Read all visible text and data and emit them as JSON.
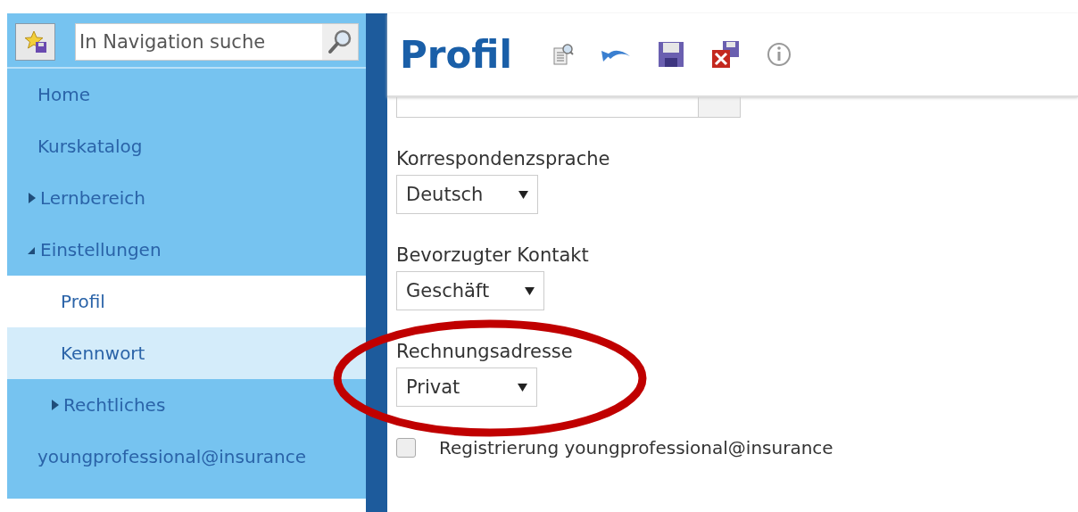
{
  "sidebar": {
    "search": {
      "placeholder": "In Navigation suche"
    },
    "items": [
      {
        "label": "Home",
        "selected": false,
        "hovered": false
      },
      {
        "label": "Kurskatalog",
        "selected": false,
        "hovered": false
      },
      {
        "label": "Lernbereich",
        "selected": false,
        "hovered": false,
        "expanded": false
      },
      {
        "label": "Einstellungen",
        "selected": false,
        "hovered": false,
        "expanded": true,
        "children": [
          {
            "label": "Profil",
            "selected": true,
            "hovered": false
          },
          {
            "label": "Kennwort",
            "selected": false,
            "hovered": true
          },
          {
            "label": "Rechtliches",
            "selected": false,
            "hovered": false,
            "expanded": false
          }
        ]
      },
      {
        "label": "youngprofessional@insurance",
        "selected": false,
        "hovered": false
      }
    ]
  },
  "page": {
    "title": "Profil",
    "fields": [
      {
        "label": "Korrespondenzsprache",
        "value": "Deutsch",
        "circled": false
      },
      {
        "label": "Bevorzugter Kontakt",
        "value": "Geschäft",
        "circled": false
      },
      {
        "label": "Rechnungsadresse",
        "value": "Privat",
        "circled": true
      }
    ],
    "checkbox": {
      "label": "Registrierung youngprofessional@insurance",
      "checked": false
    }
  }
}
